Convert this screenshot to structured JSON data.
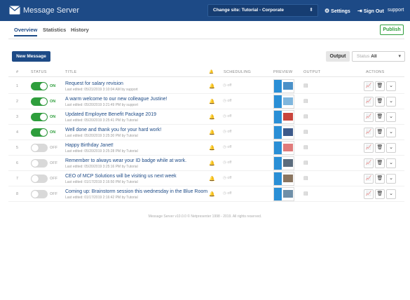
{
  "app": {
    "title": "Message Server"
  },
  "topbar": {
    "site_select": "Change site: Tutorial - Corporate",
    "settings_label": "Settings",
    "signout_label": "Sign Out",
    "user_label": "support"
  },
  "tabs": [
    {
      "label": "Overview",
      "active": true
    },
    {
      "label": "Statistics",
      "active": false
    },
    {
      "label": "History",
      "active": false
    }
  ],
  "publish_label": "Publish",
  "toolbar": {
    "new_message_label": "New Message",
    "output_label": "Output",
    "status_label": "Status",
    "status_value": "All"
  },
  "table": {
    "headers": {
      "num": "#",
      "status": "STATUS",
      "title": "TITLE",
      "scheduling": "SCHEDULING",
      "preview": "PREVIEW",
      "output": "OUTPUT",
      "actions": "ACTIONS"
    },
    "rows": [
      {
        "num": "1",
        "on": true,
        "state": "ON",
        "title": "Request for salary revision",
        "sub": "Last edited: 05/21/2019 3:10:04 AM by support",
        "sched": "off",
        "preview_color": "#4a90c8"
      },
      {
        "num": "2",
        "on": true,
        "state": "ON",
        "title": "A warm welcome to our new colleague Justine!",
        "sub": "Last edited: 05/20/2019 3:21:49 PM by support",
        "sched": "off",
        "preview_color": "#7fb6dd"
      },
      {
        "num": "3",
        "on": true,
        "state": "ON",
        "title": "Updated Employee Benefit Package 2019",
        "sub": "Last edited: 05/20/2019 3:25:41 PM by Tutorial",
        "sched": "off",
        "preview_color": "#c9443c"
      },
      {
        "num": "4",
        "on": true,
        "state": "ON",
        "title": "Well done and thank you for your hard work!",
        "sub": "Last edited: 05/20/2019 3:25:30 PM by Tutorial",
        "sched": "off",
        "preview_color": "#3d5a8a"
      },
      {
        "num": "5",
        "on": false,
        "state": "OFF",
        "title": "Happy Birthday Janet!",
        "sub": "Last edited: 05/20/2019 3:25:28 PM by Tutorial",
        "sched": "off",
        "preview_color": "#e07b7b"
      },
      {
        "num": "6",
        "on": false,
        "state": "OFF",
        "title": "Remember to always wear your ID badge while at work.",
        "sub": "Last edited: 05/20/2019 3:25:16 PM by Tutorial",
        "sched": "off",
        "preview_color": "#5b6c7d"
      },
      {
        "num": "7",
        "on": false,
        "state": "OFF",
        "title": "CEO of MCP Solutions will be visiting us next week",
        "sub": "Last edited: 01/17/2019 2:16:50 PM by Tutorial",
        "sched": "off",
        "preview_color": "#8a7560"
      },
      {
        "num": "8",
        "on": false,
        "state": "OFF",
        "title": "Coming up: Brainstorm session this wednesday in the Blue Room",
        "sub": "Last edited: 01/17/2019 2:16:42 PM by Tutorial",
        "sched": "off",
        "preview_color": "#6f8fa8"
      }
    ]
  },
  "footer": "Message Server v10.0.0 © Netpresenter 1998 - 2019. All rights reserved.",
  "colors": {
    "brand": "#1d4a86",
    "on": "#2e9e3c",
    "preview_band": "#2a8fd6"
  },
  "icons": {
    "logo": "envelope-icon",
    "settings": "gear-icon",
    "signout": "sign-out-icon",
    "notify": "bell-icon",
    "schedule": "clock-icon",
    "output": "screen-icon",
    "stats": "chart-icon",
    "delete": "trash-icon",
    "more": "chevron-down-icon"
  }
}
